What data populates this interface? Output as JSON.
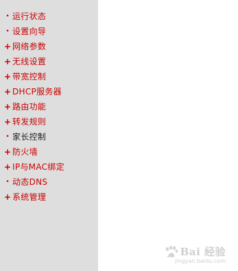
{
  "sidebar": {
    "colors": {
      "background": "#dedede",
      "item_active_text": "#cc0000",
      "item_text": "#222222",
      "bullet": "#cc0000"
    },
    "items": [
      {
        "label": "运行状态",
        "bullet": "•",
        "color": "#cc0000"
      },
      {
        "label": "设置向导",
        "bullet": "•",
        "color": "#cc0000"
      },
      {
        "label": "网络参数",
        "bullet": "+",
        "color": "#cc0000"
      },
      {
        "label": "无线设置",
        "bullet": "+",
        "color": "#cc0000"
      },
      {
        "label": "带宽控制",
        "bullet": "+",
        "color": "#cc0000"
      },
      {
        "label": "DHCP服务器",
        "bullet": "+",
        "color": "#cc0000"
      },
      {
        "label": "路由功能",
        "bullet": "+",
        "color": "#cc0000"
      },
      {
        "label": "转发规则",
        "bullet": "+",
        "color": "#cc0000"
      },
      {
        "label": "家长控制",
        "bullet": "•",
        "color": "#222222"
      },
      {
        "label": "防火墙",
        "bullet": "+",
        "color": "#cc0000"
      },
      {
        "label": "IP与MAC绑定",
        "bullet": "+",
        "color": "#cc0000"
      },
      {
        "label": "动态DNS",
        "bullet": "•",
        "color": "#cc0000"
      },
      {
        "label": "系统管理",
        "bullet": "+",
        "color": "#cc0000"
      }
    ]
  },
  "watermark": {
    "text": "Bai 经验",
    "sub": "jingyan.baidu.com",
    "icon": "paw-icon"
  }
}
